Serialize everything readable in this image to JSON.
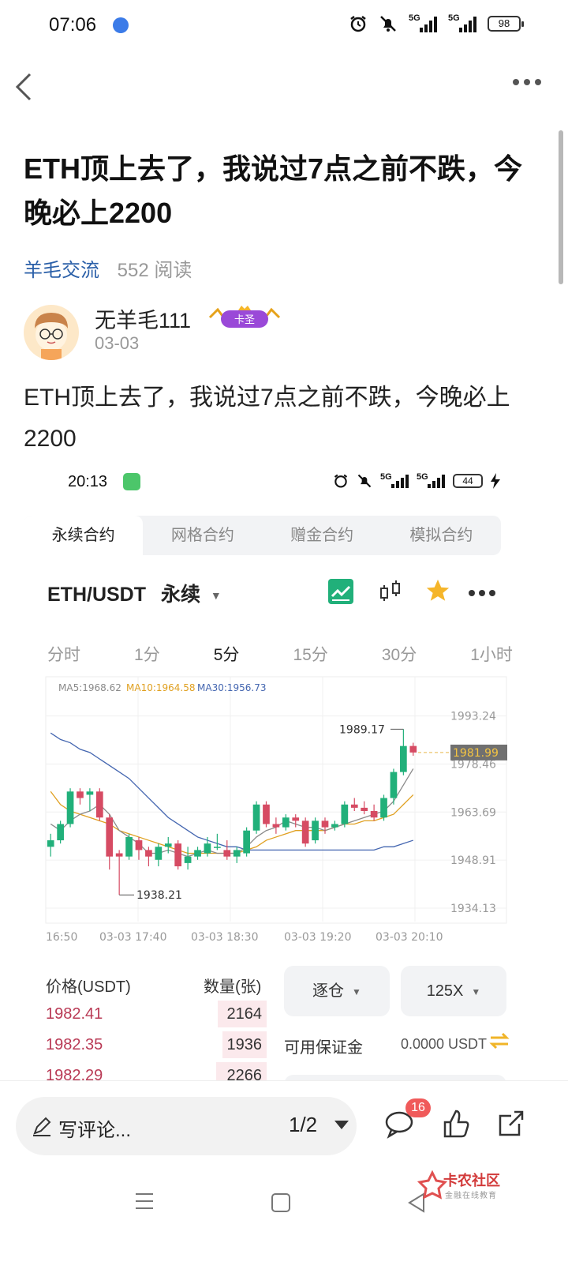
{
  "status_bar": {
    "time": "07:06",
    "battery": "98",
    "signal1": "5G",
    "signal2": "5G"
  },
  "post": {
    "title": "ETH顶上去了，我说过7点之前不跌，今晚必上2200",
    "forum": "羊毛交流",
    "reads": "552 阅读",
    "author": "无羊毛111",
    "badge": "卡圣",
    "date": "03-03",
    "body": "ETH顶上去了，我说过7点之前不跌，今晚必上2200"
  },
  "shot": {
    "status": {
      "time": "20:13",
      "battery": "44",
      "signal1": "5G",
      "signal2": "5G"
    },
    "tabs": [
      "永续合约",
      "网格合约",
      "赠金合约",
      "模拟合约"
    ],
    "pair": "ETH/USDT",
    "pair_type": "永续",
    "intervals": [
      "分时",
      "1分",
      "5分",
      "15分",
      "30分",
      "1小时"
    ],
    "active_interval": "5分",
    "orderbook": {
      "price_header": "价格(USDT)",
      "qty_header": "数量(张)",
      "rows": [
        {
          "price": "1982.41",
          "qty": "2164",
          "depth": 0.22
        },
        {
          "price": "1982.35",
          "qty": "1936",
          "depth": 0.2
        },
        {
          "price": "1982.29",
          "qty": "2266",
          "depth": 0.23
        }
      ]
    },
    "margin_mode": "逐仓",
    "leverage": "125X",
    "available_margin_label": "可用保证金",
    "available_margin_value": "0.0000 USDT"
  },
  "chart_data": {
    "type": "candlestick",
    "symbol": "ETH/USDT",
    "interval": "5分",
    "ma_legend": {
      "ma5": "MA5:1968.62",
      "ma10": "MA10:1964.58",
      "ma30": "MA30:1956.73"
    },
    "y_ticks": [
      "1993.24",
      "1978.46",
      "1963.69",
      "1948.91",
      "1934.13"
    ],
    "ylim": [
      1930,
      1998
    ],
    "x_ticks": [
      "16:50",
      "03-03 17:40",
      "03-03 18:30",
      "03-03 19:20",
      "03-03 20:10"
    ],
    "last_price": "1981.99",
    "high_label": "1989.17",
    "low_label": "1938.21",
    "colors": {
      "up": "#21b07a",
      "down": "#d64b63",
      "ma5": "#8a8a8a",
      "ma10": "#e0a020",
      "ma30": "#4466b0"
    },
    "candles": [
      [
        1953,
        1955,
        1957,
        1950
      ],
      [
        1955,
        1960,
        1961,
        1954
      ],
      [
        1960,
        1970,
        1971,
        1959
      ],
      [
        1970,
        1968,
        1971,
        1966
      ],
      [
        1969,
        1970,
        1971,
        1964
      ],
      [
        1970,
        1962,
        1971,
        1961
      ],
      [
        1962,
        1950,
        1963,
        1946
      ],
      [
        1951,
        1950,
        1952,
        1938.21
      ],
      [
        1950,
        1956,
        1957,
        1949
      ],
      [
        1955,
        1952,
        1956,
        1949
      ],
      [
        1952,
        1950,
        1953,
        1947
      ],
      [
        1949,
        1953,
        1954,
        1947
      ],
      [
        1953,
        1954,
        1956,
        1951
      ],
      [
        1954,
        1947,
        1955,
        1946
      ],
      [
        1948,
        1950,
        1953,
        1946
      ],
      [
        1950,
        1952,
        1953,
        1949
      ],
      [
        1951,
        1954,
        1956,
        1950
      ],
      [
        1953,
        1953,
        1957,
        1952
      ],
      [
        1952,
        1950,
        1955,
        1949
      ],
      [
        1950,
        1952,
        1953,
        1948
      ],
      [
        1951,
        1958,
        1959,
        1950
      ],
      [
        1958,
        1966,
        1967,
        1957
      ],
      [
        1966,
        1960,
        1967,
        1959
      ],
      [
        1960,
        1959,
        1962,
        1957
      ],
      [
        1959,
        1962,
        1963,
        1958
      ],
      [
        1962,
        1961,
        1963,
        1959
      ],
      [
        1961,
        1954,
        1962,
        1953
      ],
      [
        1955,
        1961,
        1962,
        1954
      ],
      [
        1961,
        1959,
        1962,
        1957
      ],
      [
        1959,
        1960,
        1961,
        1958
      ],
      [
        1960,
        1966,
        1967,
        1959
      ],
      [
        1966,
        1965,
        1968,
        1964
      ],
      [
        1965,
        1964,
        1967,
        1963
      ],
      [
        1964,
        1962,
        1966,
        1961
      ],
      [
        1962,
        1968,
        1969,
        1961
      ],
      [
        1968,
        1976,
        1977,
        1966
      ],
      [
        1976,
        1984,
        1989.17,
        1975
      ],
      [
        1984,
        1982,
        1985,
        1981
      ]
    ],
    "ma5": [
      1960,
      1958,
      1961,
      1963,
      1964,
      1966,
      1963,
      1958,
      1956,
      1954,
      1951,
      1951,
      1952,
      1951,
      1950,
      1951,
      1952,
      1951,
      1951,
      1951,
      1953,
      1956,
      1958,
      1959,
      1961,
      1960,
      1959,
      1959,
      1958,
      1959,
      1960,
      1961,
      1962,
      1963,
      1964,
      1967,
      1972,
      1977
    ],
    "ma10": [
      1970,
      1966,
      1964,
      1963,
      1962,
      1961,
      1960,
      1958,
      1957,
      1956,
      1955,
      1954,
      1953,
      1952,
      1951,
      1951,
      1951,
      1951,
      1951,
      1951,
      1952,
      1953,
      1955,
      1956,
      1957,
      1958,
      1958,
      1958,
      1958,
      1959,
      1960,
      1960,
      1961,
      1961,
      1962,
      1963,
      1966,
      1969
    ],
    "ma30": [
      1988,
      1986,
      1985,
      1983,
      1982,
      1980,
      1978,
      1976,
      1974,
      1971,
      1968,
      1965,
      1962,
      1960,
      1958,
      1956,
      1955,
      1954,
      1953,
      1953,
      1952,
      1952,
      1952,
      1952,
      1952,
      1952,
      1952,
      1952,
      1952,
      1952,
      1952,
      1952,
      1952,
      1952,
      1953,
      1953,
      1954,
      1955
    ]
  },
  "bottom": {
    "comment_placeholder": "写评论...",
    "page_indicator": "1/2",
    "comment_count": "16",
    "watermark_title": "卡农社区",
    "watermark_sub": "金融在线教育"
  }
}
